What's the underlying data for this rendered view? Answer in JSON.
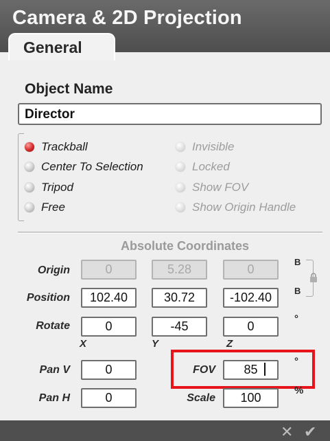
{
  "window": {
    "title": "Camera & 2D Projection"
  },
  "tabs": [
    {
      "label": "General"
    }
  ],
  "object": {
    "label": "Object Name",
    "value": "Director"
  },
  "mode_options": [
    {
      "label": "Trackball",
      "selected": true
    },
    {
      "label": "Center To Selection",
      "selected": false
    },
    {
      "label": "Tripod",
      "selected": false
    },
    {
      "label": "Free",
      "selected": false
    }
  ],
  "toggle_options": [
    {
      "label": "Invisible",
      "enabled": false
    },
    {
      "label": "Locked",
      "enabled": false
    },
    {
      "label": "Show FOV",
      "enabled": false
    },
    {
      "label": "Show Origin Handle",
      "enabled": false
    }
  ],
  "coordinates": {
    "title": "Absolute Coordinates",
    "origin": {
      "label": "Origin",
      "values": [
        "0",
        "5.28",
        "0"
      ],
      "suffix": "B"
    },
    "position": {
      "label": "Position",
      "values": [
        "102.40",
        "30.72",
        "-102.40"
      ],
      "suffix": "B"
    },
    "rotate": {
      "label": "Rotate",
      "values": [
        "0",
        "-45",
        "0"
      ],
      "suffix": "°"
    },
    "axes": [
      "X",
      "Y",
      "Z"
    ]
  },
  "pan_v": {
    "label": "Pan V",
    "value": "0"
  },
  "pan_h": {
    "label": "Pan H",
    "value": "0"
  },
  "fov": {
    "label": "FOV",
    "value": "85",
    "suffix": "°"
  },
  "scale": {
    "label": "Scale",
    "value": "100",
    "suffix": "%"
  },
  "footer": {
    "cancel_icon": "x-icon",
    "ok_icon": "check-icon"
  },
  "colors": {
    "header": "#575757",
    "highlight": "#e8141c",
    "selected_radio": "#d42a2a"
  }
}
